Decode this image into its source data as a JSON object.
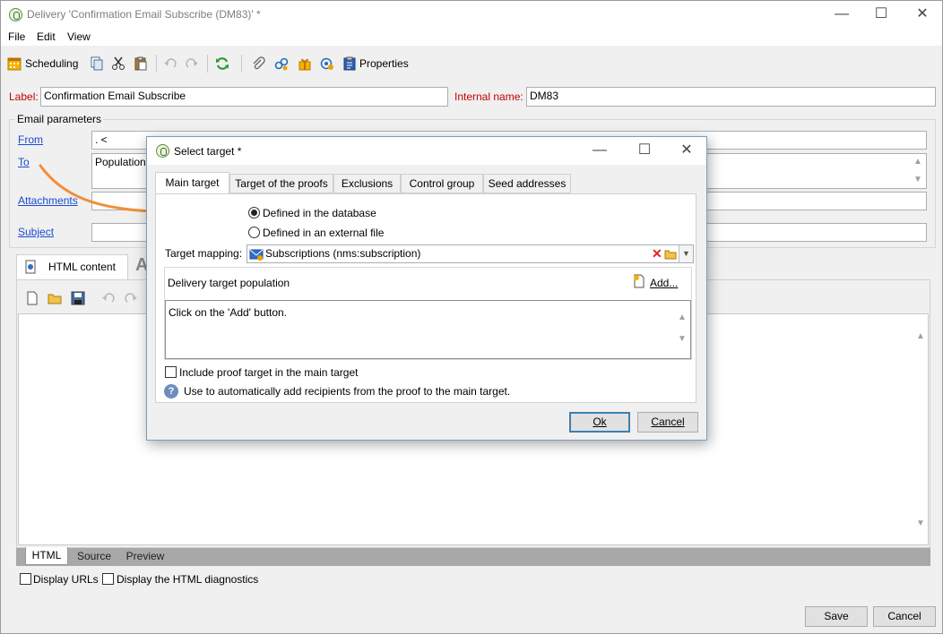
{
  "window": {
    "title": "Delivery 'Confirmation Email Subscribe (DM83)' *",
    "minimize": "—",
    "maximize": "☐",
    "close": "✕"
  },
  "menu": {
    "file": "File",
    "edit": "Edit",
    "view": "View"
  },
  "toolbar": {
    "scheduling": "Scheduling",
    "properties": "Properties"
  },
  "form": {
    "label_caption": "Label:",
    "label_value": "Confirmation Email Subscribe",
    "internal_name_caption": "Internal name:",
    "internal_name_value": "DM83",
    "email_params_title": "Email parameters",
    "from_caption": "From",
    "from_value": ".          <           ",
    "to_caption": "To",
    "to_value": "Population",
    "attachments_caption": "Attachments",
    "subject_caption": "Subject"
  },
  "content_tabs": {
    "html_content": "HTML content",
    "second_tab_glyph": "A"
  },
  "bottom_tabs": {
    "html": "HTML",
    "source": "Source",
    "preview": "Preview"
  },
  "options": {
    "display_urls": "Display URLs",
    "display_html_diag": "Display the HTML diagnostics"
  },
  "footer": {
    "save": "Save",
    "cancel": "Cancel"
  },
  "dialog": {
    "title": "Select target *",
    "tabs": [
      "Main target",
      "Target of the proofs",
      "Exclusions",
      "Control group",
      "Seed addresses"
    ],
    "radio_db": "Defined in the database",
    "radio_file": "Defined in an external file",
    "target_mapping_caption": "Target mapping:",
    "target_mapping_value": "Subscriptions (nms:subscription)",
    "population_title": "Delivery target population",
    "add_label": "Add...",
    "population_hint": "Click on the 'Add' button.",
    "include_proof": "Include proof target in the main target",
    "info_text": "Use to automatically add recipients from the proof to the main target.",
    "ok": "Ok",
    "cancel": "Cancel"
  },
  "colors": {
    "accent_orange": "#f0903a",
    "label_red": "#c00000",
    "link_blue": "#1a4bd1"
  }
}
